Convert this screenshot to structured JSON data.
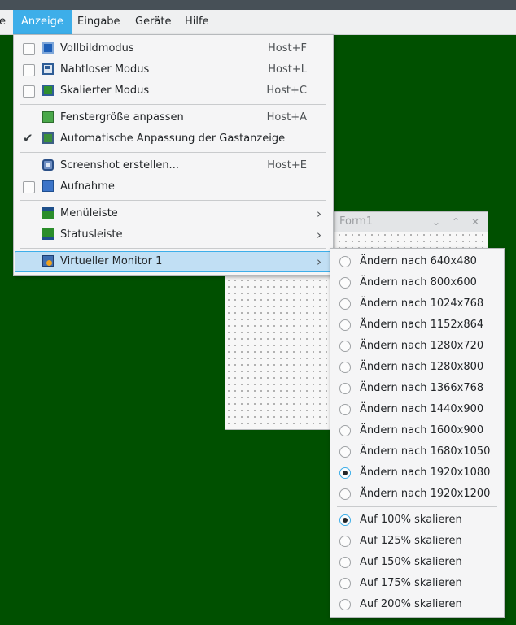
{
  "menubar": {
    "items": [
      {
        "label": "e"
      },
      {
        "label": "Anzeige"
      },
      {
        "label": "Eingabe"
      },
      {
        "label": "Geräte"
      },
      {
        "label": "Hilfe"
      }
    ]
  },
  "form_window": {
    "title": "Form1"
  },
  "anzeige_menu": {
    "items": [
      {
        "label": "Vollbildmodus",
        "shortcut": "Host+F",
        "checkbox": "unchecked",
        "icon": "fullscreen-icon"
      },
      {
        "label": "Nahtloser Modus",
        "shortcut": "Host+L",
        "checkbox": "unchecked",
        "icon": "seamless-icon"
      },
      {
        "label": "Skalierter Modus",
        "shortcut": "Host+C",
        "checkbox": "unchecked",
        "icon": "scaled-icon"
      },
      {
        "label": "Fenstergröße anpassen",
        "shortcut": "Host+A",
        "icon": "window-resize-icon"
      },
      {
        "label": "Automatische Anpassung der Gastanzeige",
        "shortcut": "",
        "checkbox": "checked",
        "icon": "auto-resize-icon"
      },
      {
        "label": "Screenshot erstellen...",
        "shortcut": "Host+E",
        "icon": "screenshot-icon"
      },
      {
        "label": "Aufnahme",
        "shortcut": "",
        "checkbox": "unchecked",
        "icon": "record-icon"
      },
      {
        "label": "Menüleiste",
        "submenu": true,
        "icon": "menubar-icon"
      },
      {
        "label": "Statusleiste",
        "submenu": true,
        "icon": "statusbar-icon"
      },
      {
        "label": "Virtueller Monitor 1",
        "submenu": true,
        "highlighted": true,
        "icon": "virtual-monitor-icon"
      }
    ]
  },
  "monitor_submenu": {
    "resolutions": [
      {
        "label": "Ändern nach 640x480",
        "selected": false
      },
      {
        "label": "Ändern nach 800x600",
        "selected": false
      },
      {
        "label": "Ändern nach 1024x768",
        "selected": false
      },
      {
        "label": "Ändern nach 1152x864",
        "selected": false
      },
      {
        "label": "Ändern nach 1280x720",
        "selected": false
      },
      {
        "label": "Ändern nach 1280x800",
        "selected": false
      },
      {
        "label": "Ändern nach 1366x768",
        "selected": false
      },
      {
        "label": "Ändern nach 1440x900",
        "selected": false
      },
      {
        "label": "Ändern nach 1600x900",
        "selected": false
      },
      {
        "label": "Ändern nach 1680x1050",
        "selected": false
      },
      {
        "label": "Ändern nach 1920x1080",
        "selected": true
      },
      {
        "label": "Ändern nach 1920x1200",
        "selected": false
      }
    ],
    "scales": [
      {
        "label": "Auf 100% skalieren",
        "selected": true
      },
      {
        "label": "Auf 125% skalieren",
        "selected": false
      },
      {
        "label": "Auf 150% skalieren",
        "selected": false
      },
      {
        "label": "Auf 175% skalieren",
        "selected": false
      },
      {
        "label": "Auf 200% skalieren",
        "selected": false
      }
    ]
  },
  "colors": {
    "desktop": "#005000",
    "accent": "#3daee9",
    "menu_bg": "#f5f5f6"
  }
}
